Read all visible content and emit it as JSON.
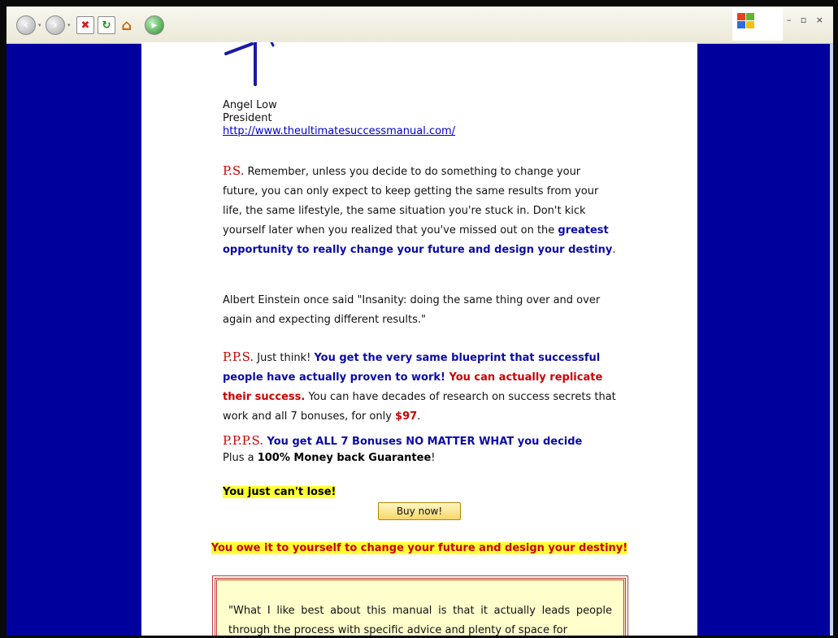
{
  "toolbar": {
    "buttons": [
      "back-icon",
      "forward-icon",
      "stop-icon",
      "refresh-icon",
      "home-icon",
      "media-icon"
    ],
    "window_controls": "– ▫ ×"
  },
  "signature": {
    "name": "Angel Low",
    "title": "President",
    "url": "http://www.theultimatesuccessmanual.com/"
  },
  "ps": {
    "label": "P.S.",
    "text1": " Remember, unless you decide to do something to change your future, you can only expect to keep getting the same results from your life, the same lifestyle, the same situation you're stuck in. Don't kick yourself later when you realized that you've missed out on the ",
    "bold": "greatest opportunity to really change your future and design your destiny",
    "text2": "."
  },
  "einstein": "Albert Einstein once said \"Insanity: doing the same thing over and over again and expecting different results.\"",
  "pps": {
    "label": "P.P.S.",
    "text1": " Just think! ",
    "blue": "You get the very same blueprint that successful people have actually proven to work!",
    "red": " You can actually replicate their success.",
    "text2": " You can have decades of research on success secrets that work and all 7 bonuses, for only ",
    "price": "$97",
    "text3": "."
  },
  "ppps": {
    "label": "P.P.P.S.",
    "blue": " You get ALL 7 Bonuses NO MATTER WHAT you decide",
    "line2_pre": "Plus a ",
    "line2_bold": "100% Money back Guarantee",
    "line2_post": "!"
  },
  "cant_lose": "You just can't lose!",
  "buy_button": "Buy now!",
  "tagline": "You owe it to yourself to change your future and design your destiny!",
  "testimonial": "\"What I like best about this manual is that it actually leads people through the process with specific advice and plenty of space for"
}
